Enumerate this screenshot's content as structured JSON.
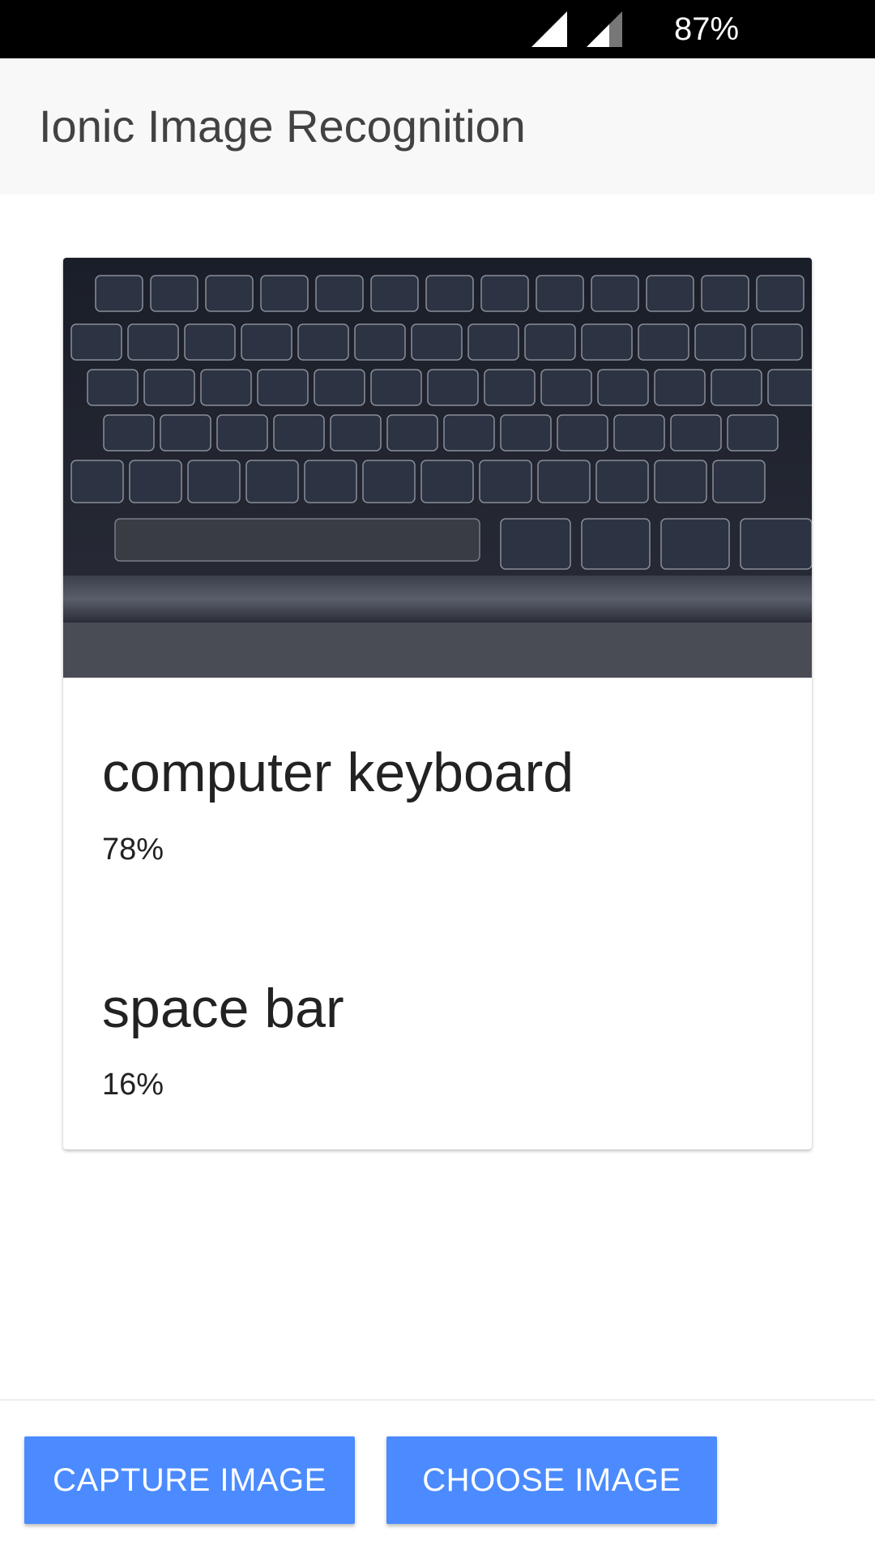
{
  "status_bar": {
    "battery": "87%",
    "icons": [
      "signal-icon",
      "signal-icon"
    ]
  },
  "header": {
    "title": "Ionic Image Recognition"
  },
  "card": {
    "image_subject": "keyboard-photo",
    "results": [
      {
        "label": "computer keyboard",
        "score": "78%"
      },
      {
        "label": "space bar",
        "score": "16%"
      }
    ]
  },
  "footer": {
    "capture_label": "CAPTURE IMAGE",
    "choose_label": "CHOOSE IMAGE"
  },
  "colors": {
    "status_bar_bg": "#000000",
    "toolbar_bg": "#f8f8f8",
    "button_bg": "#4b8bff",
    "button_text": "#ffffff",
    "text_dark": "#222222"
  }
}
